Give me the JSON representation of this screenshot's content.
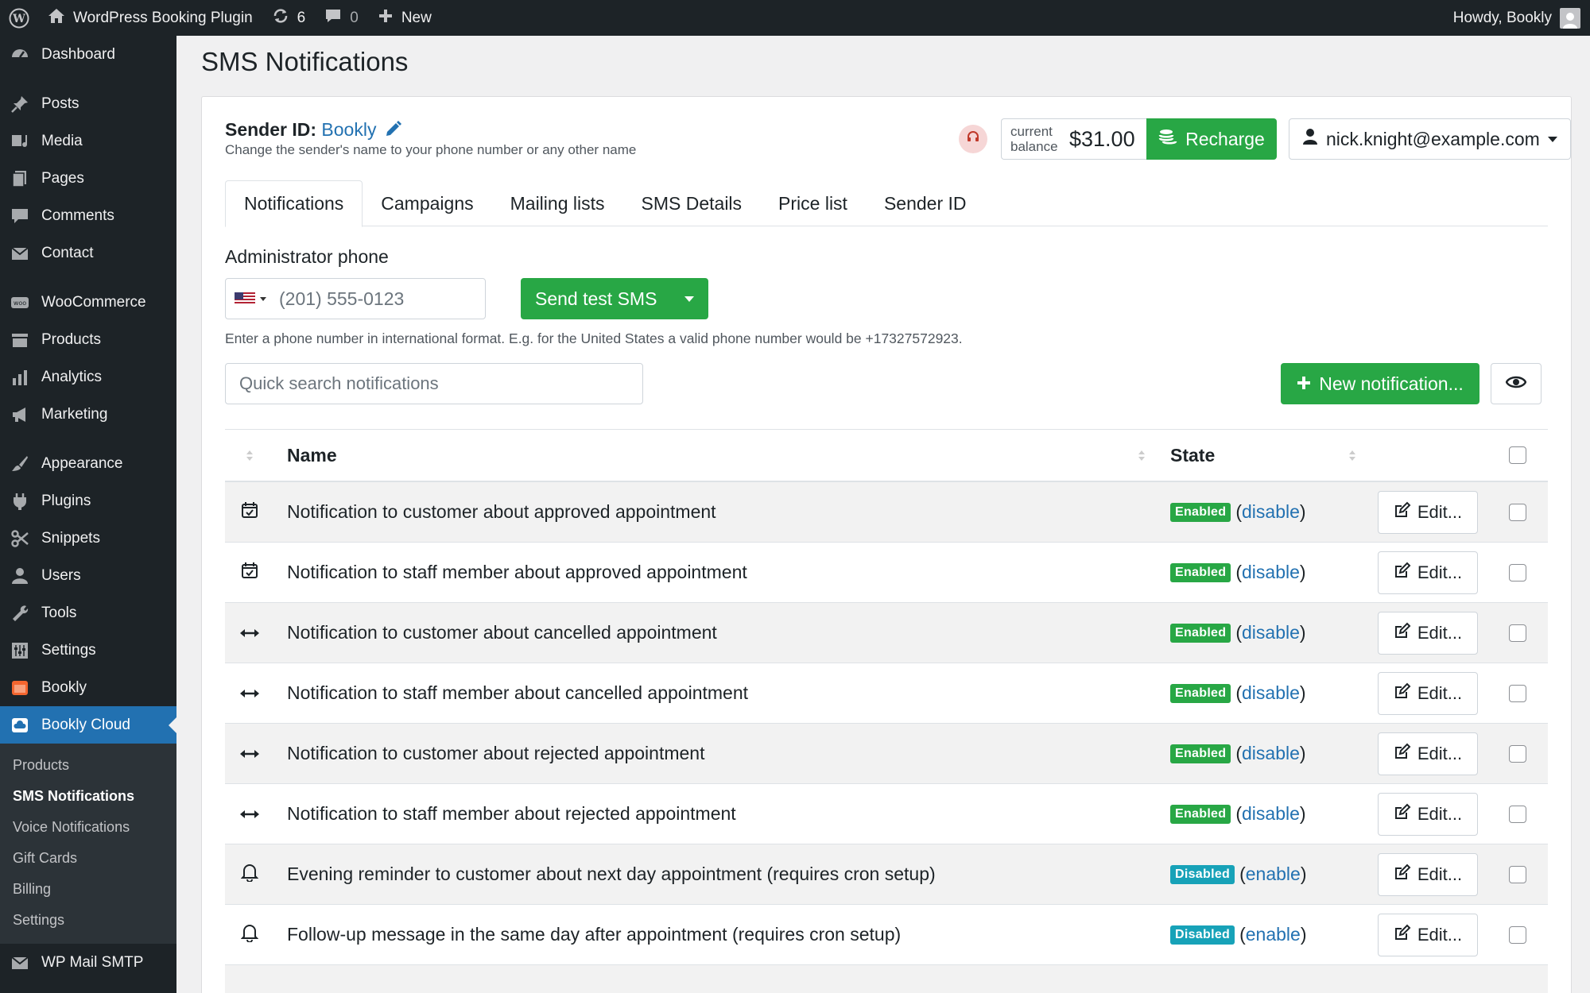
{
  "adminbar": {
    "site_name": "WordPress Booking Plugin",
    "updates_count": "6",
    "comments_count": "0",
    "new_label": "New",
    "howdy": "Howdy, Bookly"
  },
  "sidebar": {
    "items": [
      {
        "label": "Dashboard",
        "icon": "dashboard-icon"
      },
      {
        "label": "Posts",
        "icon": "pin-icon"
      },
      {
        "label": "Media",
        "icon": "media-icon"
      },
      {
        "label": "Pages",
        "icon": "pages-icon"
      },
      {
        "label": "Comments",
        "icon": "comments-icon"
      },
      {
        "label": "Contact",
        "icon": "mail-icon"
      },
      {
        "label": "WooCommerce",
        "icon": "woo-icon"
      },
      {
        "label": "Products",
        "icon": "archive-icon"
      },
      {
        "label": "Analytics",
        "icon": "chart-icon"
      },
      {
        "label": "Marketing",
        "icon": "megaphone-icon"
      },
      {
        "label": "Appearance",
        "icon": "brush-icon"
      },
      {
        "label": "Plugins",
        "icon": "plugin-icon"
      },
      {
        "label": "Snippets",
        "icon": "scissors-icon"
      },
      {
        "label": "Users",
        "icon": "user-icon"
      },
      {
        "label": "Tools",
        "icon": "wrench-icon"
      },
      {
        "label": "Settings",
        "icon": "settings-icon"
      },
      {
        "label": "Bookly",
        "icon": "bookly-icon"
      },
      {
        "label": "Bookly Cloud",
        "icon": "cloud-icon"
      }
    ],
    "submenu": [
      "Products",
      "SMS Notifications",
      "Voice Notifications",
      "Gift Cards",
      "Billing",
      "Settings"
    ],
    "bottom_item": "WP Mail SMTP"
  },
  "page": {
    "title": "SMS Notifications",
    "sender_label": "Sender ID:",
    "sender_value": "Bookly",
    "sender_help": "Change the sender's name to your phone number or any other name",
    "balance_label_1": "current",
    "balance_label_2": "balance",
    "balance_value": "$31.00",
    "recharge_label": "Recharge",
    "account_email": "nick.knight@example.com",
    "tabs": [
      "Notifications",
      "Campaigns",
      "Mailing lists",
      "SMS Details",
      "Price list",
      "Sender ID"
    ],
    "admin_phone_label": "Administrator phone",
    "phone_value": "(201) 555-0123",
    "send_test_label": "Send test SMS",
    "phone_help": "Enter a phone number in international format. E.g. for the United States a valid phone number would be +17327572923.",
    "search_placeholder": "Quick search notifications",
    "new_notification_label": "New notification..."
  },
  "table": {
    "col_name": "Name",
    "col_state": "State",
    "edit_label": "Edit...",
    "rows": [
      {
        "icon": "calendar-check-icon",
        "name": "Notification to customer about approved appointment",
        "state": "Enabled",
        "action": "disable"
      },
      {
        "icon": "calendar-check-icon",
        "name": "Notification to staff member about approved appointment",
        "state": "Enabled",
        "action": "disable"
      },
      {
        "icon": "arrows-h-icon",
        "name": "Notification to customer about cancelled appointment",
        "state": "Enabled",
        "action": "disable"
      },
      {
        "icon": "arrows-h-icon",
        "name": "Notification to staff member about cancelled appointment",
        "state": "Enabled",
        "action": "disable"
      },
      {
        "icon": "arrows-h-icon",
        "name": "Notification to customer about rejected appointment",
        "state": "Enabled",
        "action": "disable"
      },
      {
        "icon": "arrows-h-icon",
        "name": "Notification to staff member about rejected appointment",
        "state": "Enabled",
        "action": "disable"
      },
      {
        "icon": "bell-icon",
        "name": "Evening reminder to customer about next day appointment (requires cron setup)",
        "state": "Disabled",
        "action": "enable"
      },
      {
        "icon": "bell-icon",
        "name": "Follow-up message in the same day after appointment (requires cron setup)",
        "state": "Disabled",
        "action": "enable"
      }
    ]
  },
  "colors": {
    "admin_dark": "#1d2327",
    "active_blue": "#2271b1",
    "success_green": "#28a745",
    "info_teal": "#17a2b8"
  }
}
